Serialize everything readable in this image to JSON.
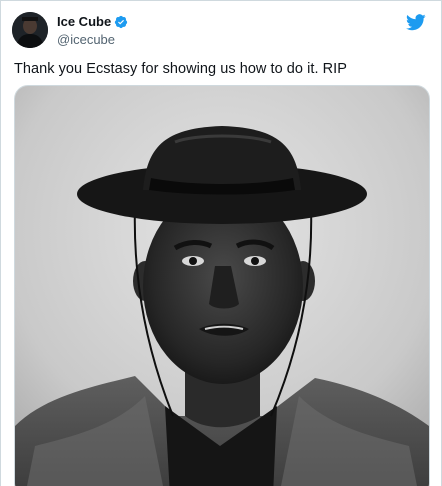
{
  "author": {
    "display_name": "Ice Cube",
    "handle": "@icecube",
    "verified": true,
    "avatar_icon": "avatar-photo"
  },
  "brand": {
    "icon": "twitter-bird-icon",
    "color": "#1d9bf0"
  },
  "tweet": {
    "text": "Thank you Ecstasy for showing us how to do it. RIP"
  },
  "media": {
    "kind": "black-and-white portrait photo",
    "icon": "tweet-photo"
  }
}
